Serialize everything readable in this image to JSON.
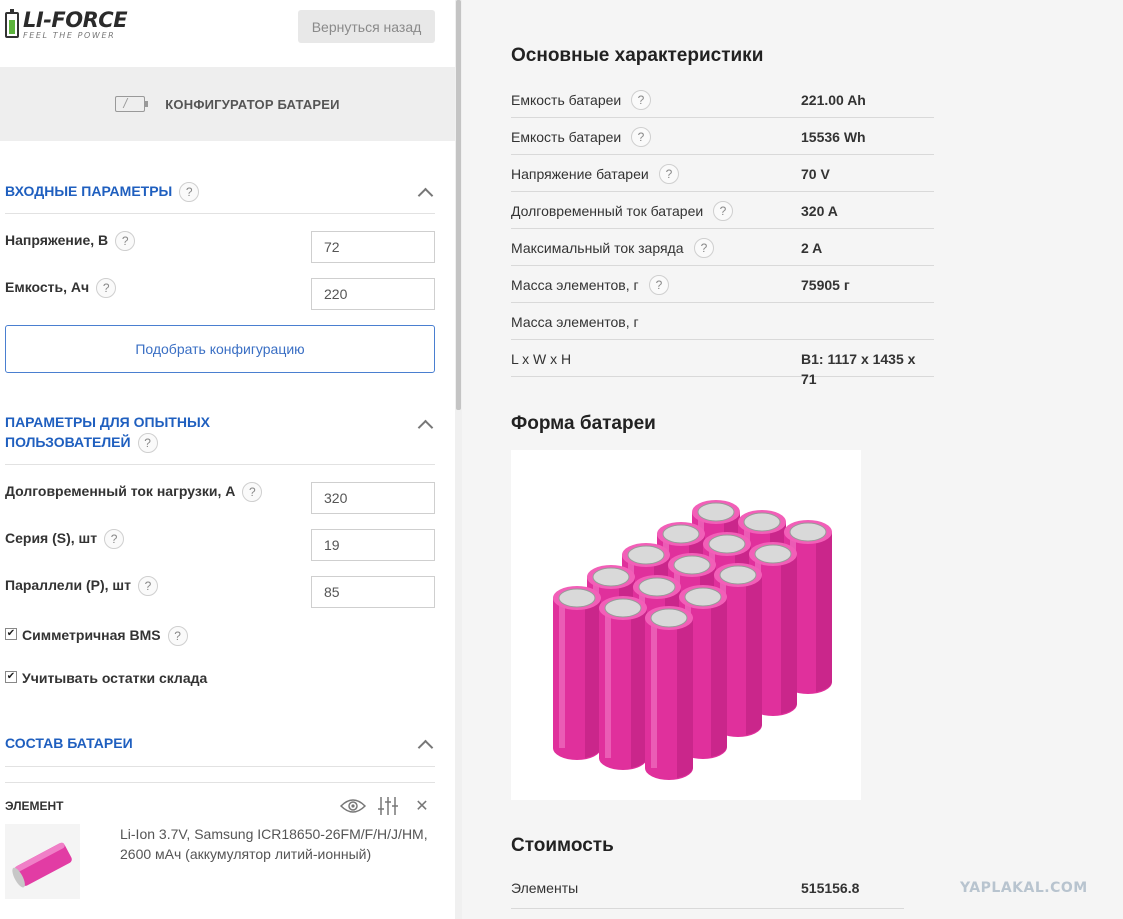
{
  "header": {
    "logo_brand": "LI-FORCE",
    "logo_slogan": "FEEL THE POWER",
    "back_button": "Вернуться назад"
  },
  "configurator": {
    "title": "КОНФИГУРАТОР БАТАРЕИ"
  },
  "input_params": {
    "title": "ВХОДНЫЕ ПАРАМЕТРЫ",
    "voltage_label": "Напряжение, В",
    "voltage_value": "72",
    "capacity_label": "Емкость, Ач",
    "capacity_value": "220",
    "pick_button": "Подобрать конфигурацию"
  },
  "advanced_params": {
    "title_line1": "ПАРАМЕТРЫ ДЛЯ ОПЫТНЫХ",
    "title_line2": "ПОЛЬЗОВАТЕЛЕЙ",
    "load_current_label": "Долговременный ток нагрузки, А",
    "load_current_value": "320",
    "series_label": "Серия (S), шт",
    "series_value": "19",
    "parallel_label": "Параллели (P), шт",
    "parallel_value": "85",
    "sym_bms_label": "Симметричная BMS",
    "sym_bms_checked": true,
    "stock_label": "Учитывать остатки склада",
    "stock_checked": true
  },
  "composition": {
    "title": "СОСТАВ БАТАРЕИ",
    "element_label": "ЭЛЕМЕНТ",
    "element_desc": "Li-Ion 3.7V, Samsung ICR18650-26FM/F/H/J/HM, 2600 мАч (аккумулятор литий-ионный)"
  },
  "specs": {
    "title": "Основные характеристики",
    "rows": [
      {
        "key": "Емкость батареи",
        "value": "221.00 Ah",
        "help": true
      },
      {
        "key": "Емкость батареи",
        "value": "15536 Wh",
        "help": true
      },
      {
        "key": "Напряжение батареи",
        "value": "70 V",
        "help": true
      },
      {
        "key": "Долговременный ток батареи",
        "value": "320 A",
        "help": true
      },
      {
        "key": "Максимальный ток заряда",
        "value": "2 A",
        "help": true
      },
      {
        "key": "Масса элементов, г",
        "value": "75905 г",
        "help": true
      },
      {
        "key": "Масса элементов, г",
        "value": "",
        "help": false
      },
      {
        "key": "L x W x H",
        "value": "B1: 1117 x 1435 x 71",
        "help": false
      }
    ]
  },
  "shape": {
    "title": "Форма батареи"
  },
  "cost": {
    "title": "Стоимость",
    "row_key": "Элементы",
    "row_value": "515156.8"
  },
  "help_glyph": "?",
  "watermark": "YAPLAKAL.COM",
  "colors": {
    "accent": "#1f5fbf",
    "cell_pink": "#e0309c",
    "logo_green": "#5cb33c"
  }
}
